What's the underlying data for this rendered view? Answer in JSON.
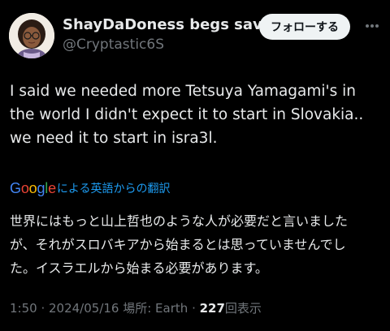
{
  "user": {
    "display_name": "ShayDaDoness begs sav...",
    "handle": "@Cryptastic6S"
  },
  "follow_button": {
    "label": "フォローする"
  },
  "more_icon": "more-horizontal-icon",
  "tweet": {
    "lines": [
      "I said we needed more Tetsuya Yamagami's in",
      "the world I didn't expect it to start in Slovakia..",
      "we need it to start in isra3l."
    ]
  },
  "translation": {
    "google_letters": [
      "G",
      "o",
      "o",
      "g",
      "l",
      "e"
    ],
    "label": "による英語からの翻訳",
    "lines": [
      "世界にはもっと山上哲也のような人が必要だと言いました",
      "が、それがスロバキアから始まるとは思っていませんでし",
      "た。イスラエルから始まる必要があります。"
    ]
  },
  "meta": {
    "time": "1:50",
    "sep1": " · ",
    "date": "2024/05/16",
    "location": " 場所: Earth",
    "sep2": " · ",
    "views_count": "227",
    "views_label": "回表示"
  },
  "colors": {
    "background": "#000000",
    "text": "#e7e9ea",
    "secondary": "#71767b",
    "link": "#1d9bf0",
    "follow_bg": "#eff3f4"
  }
}
